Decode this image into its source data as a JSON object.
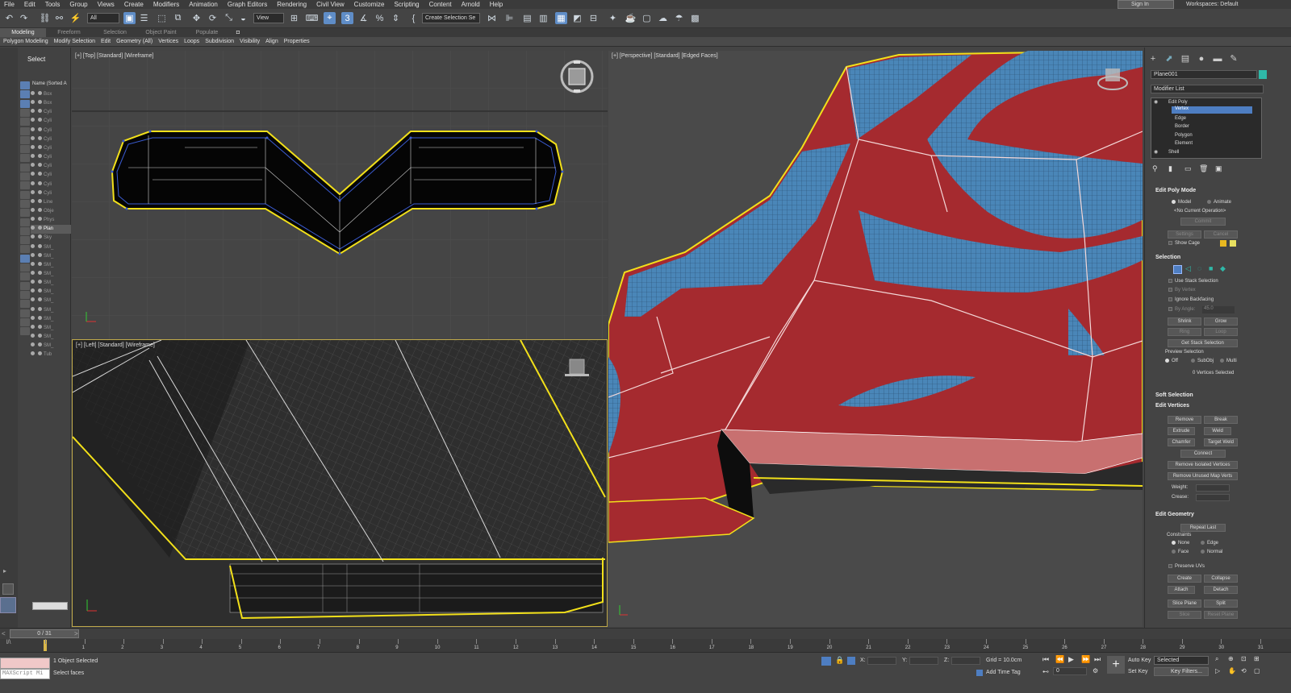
{
  "menu": [
    "File",
    "Edit",
    "Tools",
    "Group",
    "Views",
    "Create",
    "Modifiers",
    "Animation",
    "Graph Editors",
    "Rendering",
    "Civil View",
    "Customize",
    "Scripting",
    "Content",
    "Arnold",
    "Help"
  ],
  "signin": "Sign In",
  "workspace": "Workspaces: Default",
  "toolbar": {
    "filter": "All",
    "ref_coord": "View",
    "selection_set": "Create Selection Se"
  },
  "ribbon_tabs": [
    "Modeling",
    "Freeform",
    "Selection",
    "Object Paint",
    "Populate"
  ],
  "ribbon_sub": [
    "Polygon Modeling",
    "Modify Selection",
    "Edit",
    "Geometry (All)",
    "Vertices",
    "Loops",
    "Subdivision",
    "Visibility",
    "Align",
    "Properties"
  ],
  "explorer": {
    "title": "Select",
    "header": "Name (Sorted A",
    "items": [
      "Box",
      "Box",
      "Cyli",
      "Cyli",
      "Cyli",
      "Cyli",
      "Cyli",
      "Cyli",
      "Cyli",
      "Cyli",
      "Cyli",
      "Cyli",
      "Line",
      "Obje",
      "Phys",
      "Plan",
      "Sky",
      "SM_",
      "SM_",
      "SM_",
      "SM_",
      "SM_",
      "SM_",
      "SM_",
      "SM_",
      "SM_",
      "SM_",
      "SM_",
      "SM_",
      "Tub"
    ]
  },
  "viewports": {
    "top": "[+] [Top] [Standard] [Wireframe]",
    "left": "[+] [Left] [Standard] [Wireframe]",
    "persp": "[+] [Perspective] [Standard] [Edged Faces]"
  },
  "cmd": {
    "object_name": "Plane001",
    "modifier_list": "Modifier List",
    "stack": {
      "edit_poly": "Edit Poly",
      "subs": [
        "Vertex",
        "Edge",
        "Border",
        "Polygon",
        "Element"
      ],
      "shell": "Shell"
    },
    "edit_poly_mode": {
      "title": "Edit Poly Mode",
      "model": "Model",
      "animate": "Animate",
      "current_op": "<No Current Operation>",
      "commit": "Commit",
      "settings": "Settings",
      "cancel": "Cancel",
      "show_cage": "Show Cage"
    },
    "selection": {
      "title": "Selection",
      "use_stack": "Use Stack Selection",
      "by_vertex": "By Vertex",
      "ignore_bf": "Ignore Backfacing",
      "by_angle": "By Angle:",
      "angle": "45.0",
      "shrink": "Shrink",
      "grow": "Grow",
      "ring": "Ring",
      "loop": "Loop",
      "get_stack": "Get Stack Selection",
      "preview": "Preview Selection",
      "off": "Off",
      "subobj": "SubObj",
      "multi": "Multi",
      "count": "0 Vertices Selected"
    },
    "soft_selection": "Soft Selection",
    "edit_vertices": {
      "title": "Edit Vertices",
      "remove": "Remove",
      "break": "Break",
      "extrude": "Extrude",
      "weld": "Weld",
      "chamfer": "Chamfer",
      "target_weld": "Target Weld",
      "connect": "Connect",
      "remove_isolated": "Remove Isolated Vertices",
      "remove_unused": "Remove Unused Map Verts",
      "weight": "Weight:",
      "crease": "Crease:"
    },
    "edit_geometry": {
      "title": "Edit Geometry",
      "repeat_last": "Repeat Last",
      "constraints": "Constraints",
      "none": "None",
      "edge": "Edge",
      "face": "Face",
      "normal": "Normal",
      "preserve_uvs": "Preserve UVs",
      "create": "Create",
      "collapse": "Collapse",
      "attach": "Attach",
      "detach": "Detach",
      "slice_plane": "Slice Plane",
      "split": "Split",
      "slice": "Slice",
      "reset_plane": "Reset Plane"
    }
  },
  "timeline": {
    "frame": "0 / 31",
    "ticks": [
      "0",
      "1",
      "2",
      "3",
      "4",
      "5",
      "6",
      "7",
      "8",
      "9",
      "10",
      "11",
      "12",
      "13",
      "14",
      "15",
      "16",
      "17",
      "18",
      "19",
      "20",
      "21",
      "22",
      "23",
      "24",
      "25",
      "26",
      "27",
      "28",
      "29",
      "30",
      "31"
    ]
  },
  "status": {
    "maxscript": "MAXScript Mi",
    "objects": "1 Object Selected",
    "prompt": "Select faces",
    "x_label": "X:",
    "y_label": "Y:",
    "z_label": "Z:",
    "grid": "Grid = 10.0cm",
    "add_time_tag": "Add Time Tag",
    "auto_key": "Auto Key",
    "set_key": "Set Key",
    "selected": "Selected",
    "key_filters": "Key Filters...",
    "frame": "0"
  },
  "colors": {
    "accent": "#5f8dc7",
    "mesh_red": "#a52a2f",
    "mesh_blue": "#4a86b8",
    "sel_yellow": "#f2e01a"
  }
}
